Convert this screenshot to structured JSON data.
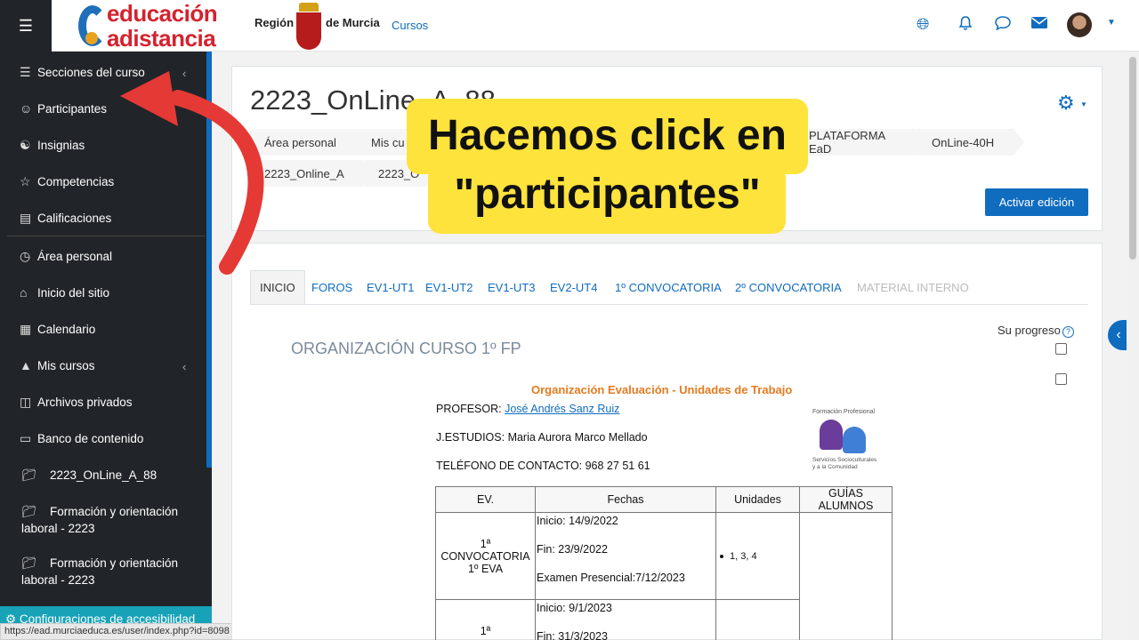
{
  "navbar": {
    "logo_line1": "educación",
    "logo_line2": "adistancia",
    "region_label": "Región",
    "region_label2": "de Murcia",
    "cursos_link": "Cursos",
    "icons": [
      "globe-icon",
      "bell-icon",
      "chat-icon",
      "mail-icon"
    ]
  },
  "sidebar": {
    "items": [
      {
        "label": "Secciones del curso",
        "icon": "list-icon"
      },
      {
        "label": "Participantes",
        "icon": "users-icon"
      },
      {
        "label": "Insignias",
        "icon": "badge-icon"
      },
      {
        "label": "Competencias",
        "icon": "star-icon"
      },
      {
        "label": "Calificaciones",
        "icon": "grades-icon"
      },
      {
        "label": "Área personal",
        "icon": "dashboard-icon"
      },
      {
        "label": "Inicio del sitio",
        "icon": "home-icon"
      },
      {
        "label": "Calendario",
        "icon": "calendar-icon"
      },
      {
        "label": "Mis cursos",
        "icon": "courses-icon"
      },
      {
        "label": "Archivos privados",
        "icon": "file-icon"
      },
      {
        "label": "Banco de contenido",
        "icon": "paste-icon"
      }
    ],
    "folders": [
      {
        "label": "2223_OnLine_A_88"
      },
      {
        "label": "Formación y orientación laboral - 2223"
      },
      {
        "label": "Formación y orientación laboral - 2223"
      }
    ],
    "accessibility": "Configuraciones de accesibilidad"
  },
  "status_url": "https://ead.murciaeduca.es/user/index.php?id=8098",
  "header": {
    "course_title": "2223_OnLine_A_88",
    "breadcrumbs": [
      "Área personal",
      "Mis cu",
      "PLATAFORMA EaD",
      "OnLine-40H",
      "2223_Online_A",
      "2223_O"
    ],
    "edit_button": "Activar edición"
  },
  "content": {
    "tabs": [
      {
        "label": "INICIO",
        "state": "active"
      },
      {
        "label": "FOROS",
        "state": "normal"
      },
      {
        "label": "EV1-UT1",
        "state": "normal"
      },
      {
        "label": "EV1-UT2",
        "state": "normal"
      },
      {
        "label": "EV1-UT3",
        "state": "normal"
      },
      {
        "label": "EV2-UT4",
        "state": "normal"
      },
      {
        "label": "1º CONVOCATORIA",
        "state": "normal"
      },
      {
        "label": "2º CONVOCATORIA",
        "state": "normal"
      },
      {
        "label": "MATERIAL INTERNO",
        "state": "disabled"
      }
    ],
    "section_title": "ORGANIZACIÓN CURSO 1º FP",
    "progress_label": "Su progreso",
    "doc": {
      "title": "Organización Evaluación - Unidades de Trabajo",
      "profesor_label": "PROFESOR:",
      "profesor_name": "José Andrés Sanz Ruiz",
      "jefe_estudios": "J.ESTUDIOS: Maria Aurora Marco Mellado",
      "telefono": "TELÉFONO DE CONTACTO: 968 27 51 61",
      "logo_top": "Formación Profesional",
      "logo_bottom1": "Servicios Socioculturales",
      "logo_bottom2": "y a la Comunidad"
    },
    "table": {
      "headers": [
        "EV.",
        "Fechas",
        "Unidades",
        "GUÍAS ALUMNOS"
      ],
      "row1": {
        "ev_line1": "1ª",
        "ev_line2": "CONVOCATORIA",
        "ev_line3": "1º EVA",
        "inicio": "Inicio: 14/9/2022",
        "fin": "Fin: 23/9/2022",
        "examen": "Examen Presencial:7/12/2023",
        "unidades": "1, 3, 4"
      },
      "row2": {
        "ev_line1": "1ª",
        "inicio": "Inicio: 9/1/2023",
        "fin": "Fin: 31/3/2023"
      }
    }
  },
  "callout": {
    "line1": "Hacemos click en",
    "line2": "\"participantes\""
  },
  "colors": {
    "accent": "#0f6cbf",
    "callout": "#fde33b",
    "arrow": "#e53935",
    "sidebar": "#212529"
  }
}
